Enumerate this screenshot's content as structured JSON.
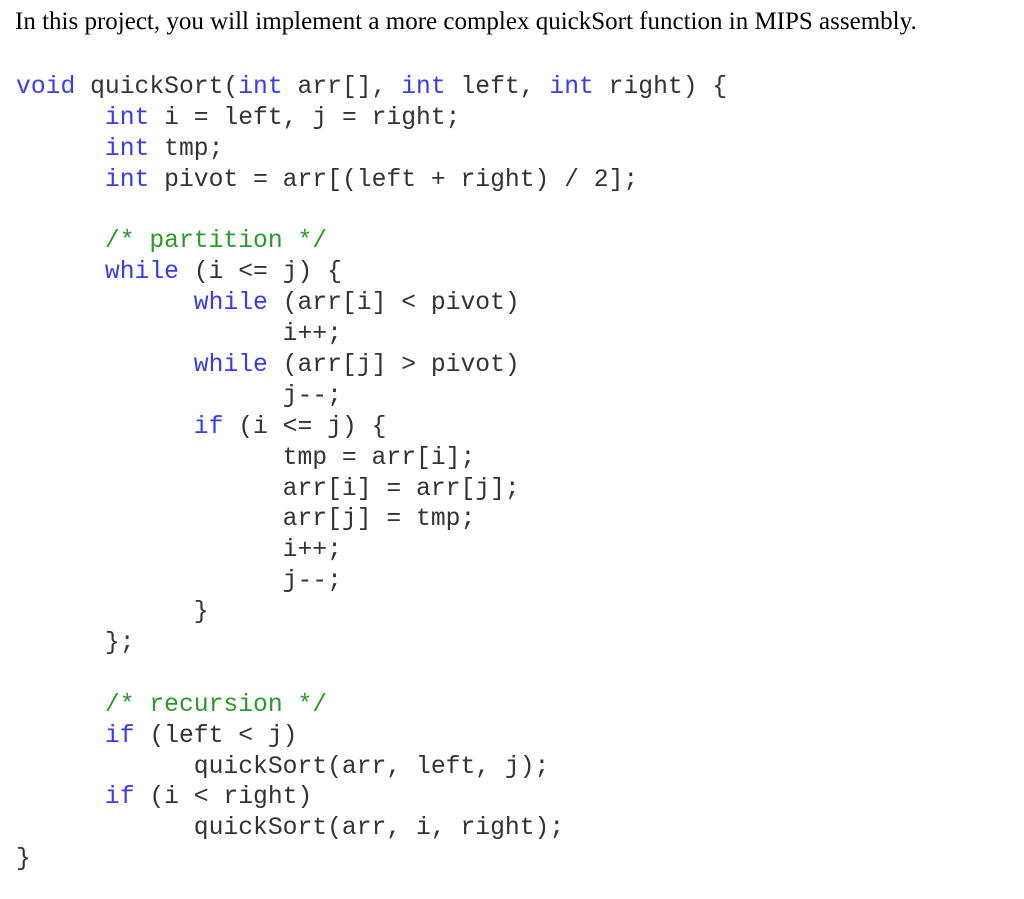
{
  "intro": "In this project, you will implement a more complex quickSort function in MIPS assembly.",
  "colors": {
    "keyword": "#3a3af0",
    "comment": "#2a9a2a",
    "text": "#333333"
  },
  "code_lines": [
    [
      {
        "t": "kw",
        "s": "void"
      },
      {
        "t": "tx",
        "s": " quickSort("
      },
      {
        "t": "kw",
        "s": "int"
      },
      {
        "t": "tx",
        "s": " arr[], "
      },
      {
        "t": "kw",
        "s": "int"
      },
      {
        "t": "tx",
        "s": " left, "
      },
      {
        "t": "kw",
        "s": "int"
      },
      {
        "t": "tx",
        "s": " right) {"
      }
    ],
    [
      {
        "t": "tx",
        "s": "      "
      },
      {
        "t": "kw",
        "s": "int"
      },
      {
        "t": "tx",
        "s": " i = left, j = right;"
      }
    ],
    [
      {
        "t": "tx",
        "s": "      "
      },
      {
        "t": "kw",
        "s": "int"
      },
      {
        "t": "tx",
        "s": " tmp;"
      }
    ],
    [
      {
        "t": "tx",
        "s": "      "
      },
      {
        "t": "kw",
        "s": "int"
      },
      {
        "t": "tx",
        "s": " pivot = arr[(left + right) / 2];"
      }
    ],
    [],
    [
      {
        "t": "tx",
        "s": "      "
      },
      {
        "t": "cm",
        "s": "/* partition */"
      }
    ],
    [
      {
        "t": "tx",
        "s": "      "
      },
      {
        "t": "kw",
        "s": "while"
      },
      {
        "t": "tx",
        "s": " (i <= j) {"
      }
    ],
    [
      {
        "t": "tx",
        "s": "            "
      },
      {
        "t": "kw",
        "s": "while"
      },
      {
        "t": "tx",
        "s": " (arr[i] < pivot)"
      }
    ],
    [
      {
        "t": "tx",
        "s": "                  i++;"
      }
    ],
    [
      {
        "t": "tx",
        "s": "            "
      },
      {
        "t": "kw",
        "s": "while"
      },
      {
        "t": "tx",
        "s": " (arr[j] > pivot)"
      }
    ],
    [
      {
        "t": "tx",
        "s": "                  j--;"
      }
    ],
    [
      {
        "t": "tx",
        "s": "            "
      },
      {
        "t": "kw",
        "s": "if"
      },
      {
        "t": "tx",
        "s": " (i <= j) {"
      }
    ],
    [
      {
        "t": "tx",
        "s": "                  tmp = arr[i];"
      }
    ],
    [
      {
        "t": "tx",
        "s": "                  arr[i] = arr[j];"
      }
    ],
    [
      {
        "t": "tx",
        "s": "                  arr[j] = tmp;"
      }
    ],
    [
      {
        "t": "tx",
        "s": "                  i++;"
      }
    ],
    [
      {
        "t": "tx",
        "s": "                  j--;"
      }
    ],
    [
      {
        "t": "tx",
        "s": "            }"
      }
    ],
    [
      {
        "t": "tx",
        "s": "      };"
      }
    ],
    [],
    [
      {
        "t": "tx",
        "s": "      "
      },
      {
        "t": "cm",
        "s": "/* recursion */"
      }
    ],
    [
      {
        "t": "tx",
        "s": "      "
      },
      {
        "t": "kw",
        "s": "if"
      },
      {
        "t": "tx",
        "s": " (left < j)"
      }
    ],
    [
      {
        "t": "tx",
        "s": "            quickSort(arr, left, j);"
      }
    ],
    [
      {
        "t": "tx",
        "s": "      "
      },
      {
        "t": "kw",
        "s": "if"
      },
      {
        "t": "tx",
        "s": " (i < right)"
      }
    ],
    [
      {
        "t": "tx",
        "s": "            quickSort(arr, i, right);"
      }
    ],
    [
      {
        "t": "tx",
        "s": "}"
      }
    ]
  ]
}
